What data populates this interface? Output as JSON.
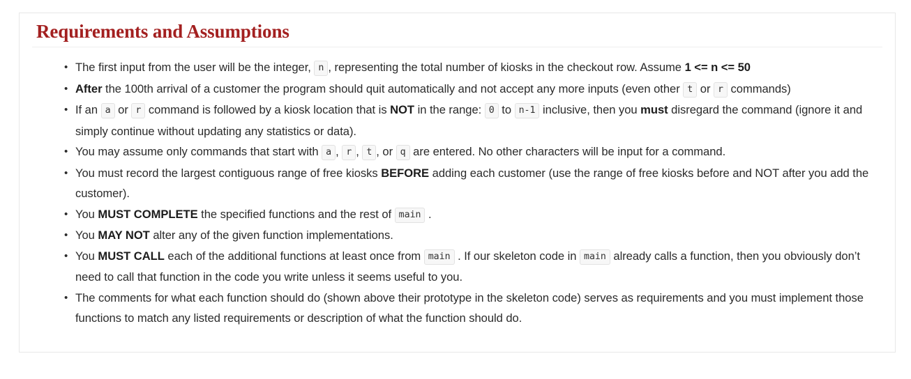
{
  "card": {
    "title": "Requirements and Assumptions",
    "title_color": "#a32020",
    "border_color": "#e7e7e7",
    "code_bg_color": "#f7f7f7",
    "code_border_color": "#e2e2e2",
    "text_color": "#2b2b2b"
  },
  "requirements": [
    {
      "id": "first-input-integer-n",
      "parts": [
        {
          "type": "text",
          "value": "The first input from the user will be the integer, "
        },
        {
          "type": "code",
          "value": "n"
        },
        {
          "type": "text",
          "value": ", representing the total number of kiosks in the checkout row. Assume "
        },
        {
          "type": "bold",
          "value": "1 <= n <= 50"
        }
      ]
    },
    {
      "id": "quit-after-100th-arrival",
      "parts": [
        {
          "type": "bold",
          "value": "After"
        },
        {
          "type": "text",
          "value": " the 100th arrival of a customer the program should quit automatically and not accept any more inputs (even other "
        },
        {
          "type": "code",
          "value": "t"
        },
        {
          "type": "text",
          "value": " or "
        },
        {
          "type": "code",
          "value": "r"
        },
        {
          "type": "text",
          "value": " commands)"
        }
      ]
    },
    {
      "id": "out-of-range-command-disregard",
      "parts": [
        {
          "type": "text",
          "value": "If an "
        },
        {
          "type": "code",
          "value": "a"
        },
        {
          "type": "text",
          "value": " or "
        },
        {
          "type": "code",
          "value": "r"
        },
        {
          "type": "text",
          "value": " command is followed by a kiosk location that is "
        },
        {
          "type": "bold",
          "value": "NOT"
        },
        {
          "type": "text",
          "value": " in the range: "
        },
        {
          "type": "code",
          "value": "0"
        },
        {
          "type": "text",
          "value": " to "
        },
        {
          "type": "code",
          "value": "n-1"
        },
        {
          "type": "text",
          "value": " inclusive, then you "
        },
        {
          "type": "bold",
          "value": "must"
        },
        {
          "type": "text",
          "value": " disregard the command (ignore it and simply continue without updating any statistics or data)."
        }
      ]
    },
    {
      "id": "valid-command-characters",
      "parts": [
        {
          "type": "text",
          "value": "You may assume only commands that start with "
        },
        {
          "type": "code",
          "value": "a"
        },
        {
          "type": "text",
          "value": ", "
        },
        {
          "type": "code",
          "value": "r"
        },
        {
          "type": "text",
          "value": ", "
        },
        {
          "type": "code",
          "value": "t"
        },
        {
          "type": "text",
          "value": ", or "
        },
        {
          "type": "code",
          "value": "q"
        },
        {
          "type": "text",
          "value": " are entered. No other characters will be input for a command."
        }
      ]
    },
    {
      "id": "record-largest-contiguous-range",
      "parts": [
        {
          "type": "text",
          "value": "You must record the largest contiguous range of free kiosks "
        },
        {
          "type": "bold",
          "value": "BEFORE"
        },
        {
          "type": "text",
          "value": " adding each customer (use the range of free kiosks before and NOT after you add the customer)."
        }
      ]
    },
    {
      "id": "must-complete-functions",
      "parts": [
        {
          "type": "text",
          "value": "You "
        },
        {
          "type": "bold",
          "value": "MUST COMPLETE"
        },
        {
          "type": "text",
          "value": " the specified functions and the rest of "
        },
        {
          "type": "code",
          "value": "main"
        },
        {
          "type": "text",
          "value": " ."
        }
      ]
    },
    {
      "id": "may-not-alter-implementations",
      "parts": [
        {
          "type": "text",
          "value": "You "
        },
        {
          "type": "bold",
          "value": "MAY NOT"
        },
        {
          "type": "text",
          "value": " alter any of the given function implementations."
        }
      ]
    },
    {
      "id": "must-call-each-function",
      "parts": [
        {
          "type": "text",
          "value": "You "
        },
        {
          "type": "bold",
          "value": "MUST CALL"
        },
        {
          "type": "text",
          "value": " each of the additional functions at least once from "
        },
        {
          "type": "code",
          "value": "main"
        },
        {
          "type": "text",
          "value": " . If our skeleton code in "
        },
        {
          "type": "code",
          "value": "main"
        },
        {
          "type": "text",
          "value": " already calls a function, then you obviously don’t need to call that function in the code you write unless it seems useful to you."
        }
      ]
    },
    {
      "id": "comments-are-requirements",
      "parts": [
        {
          "type": "text",
          "value": "The comments for what each function should do (shown above their prototype in the skeleton code) serves as requirements and you must implement those functions to match any listed requirements or description of what the function should do."
        }
      ]
    }
  ]
}
